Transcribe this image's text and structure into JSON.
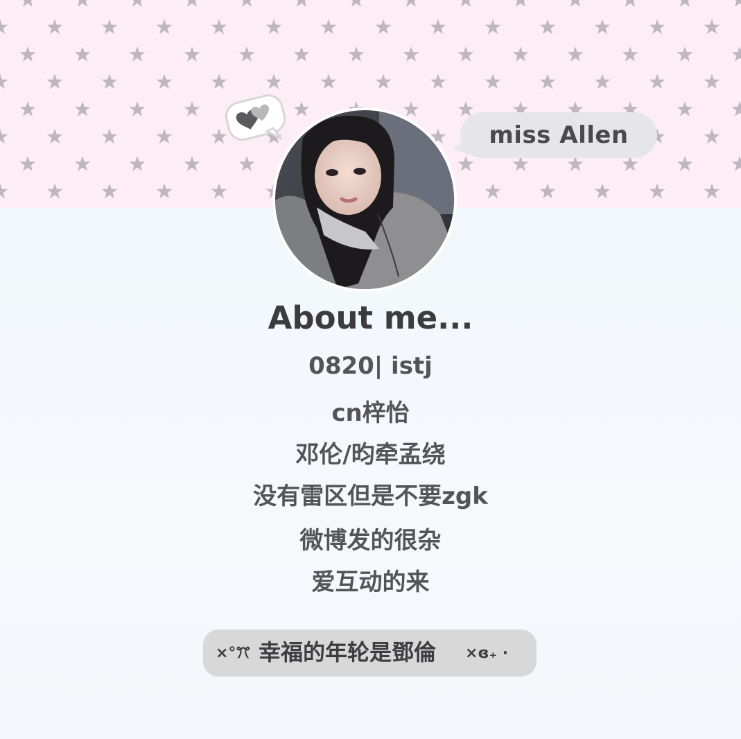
{
  "header": {
    "name_label": "miss Allen"
  },
  "profile": {
    "title": "About me...",
    "bio_lines": [
      "0820| istj",
      "cn梓怡",
      "邓伦/昀牵孟绕",
      "没有雷区但是不要zgk",
      "微博发的很杂",
      "爱互动的来"
    ]
  },
  "tag": {
    "deco_left": "×°ꔫ",
    "text": "幸福的年轮是鄧倫",
    "deco_right": "×ɞ₊ ·"
  },
  "colors": {
    "banner_bg": "#fdeef5",
    "star": "#bfb7c0",
    "page_bg": "#f4f8fb",
    "pill_bg": "#e6e6ea",
    "tag_bg": "#d8d8d9",
    "text_dark": "#3c3c3e"
  },
  "icons": {
    "heart_bubble": "grey-hearts-speech-bubble-icon",
    "star_pattern": "star-icon"
  }
}
